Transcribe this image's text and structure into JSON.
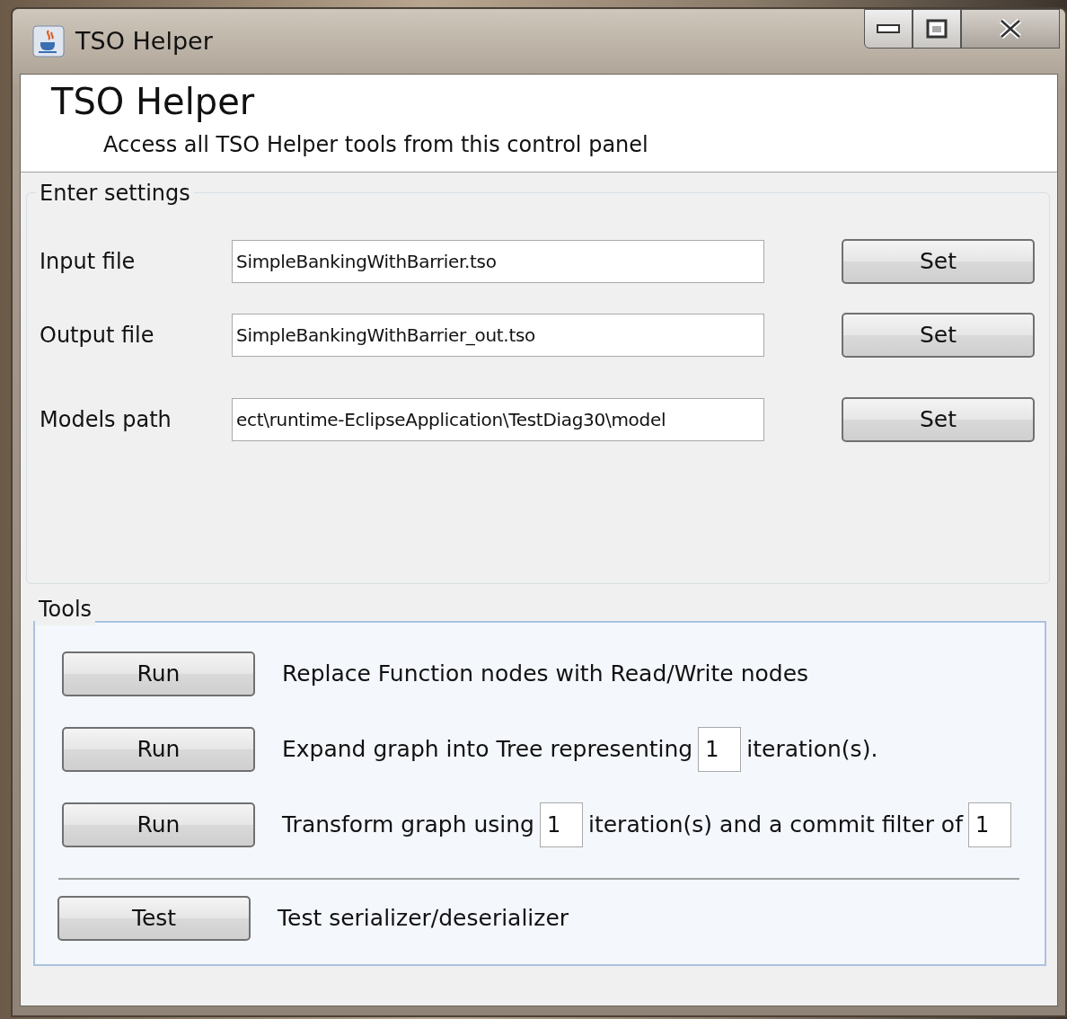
{
  "window": {
    "title": "TSO Helper"
  },
  "header": {
    "title": "TSO Helper",
    "subtitle": "Access all TSO Helper tools from this control panel"
  },
  "settings": {
    "legend": "Enter settings",
    "rows": [
      {
        "label": "Input file",
        "value": "SimpleBankingWithBarrier.tso",
        "button": "Set"
      },
      {
        "label": "Output file",
        "value": "SimpleBankingWithBarrier_out.tso",
        "button": "Set"
      },
      {
        "label": "Models path",
        "value": "ect\\runtime-EclipseApplication\\TestDiag30\\model",
        "button": "Set"
      }
    ]
  },
  "tools": {
    "legend": "Tools",
    "rows": [
      {
        "button": "Run",
        "parts": [
          {
            "kind": "text",
            "text": "Replace Function nodes with Read/Write nodes"
          }
        ]
      },
      {
        "button": "Run",
        "parts": [
          {
            "kind": "text",
            "text": "Expand graph into Tree representing"
          },
          {
            "kind": "field",
            "value": "1"
          },
          {
            "kind": "text",
            "text": "iteration(s)."
          }
        ]
      },
      {
        "button": "Run",
        "parts": [
          {
            "kind": "text",
            "text": "Transform graph using"
          },
          {
            "kind": "field",
            "value": "1"
          },
          {
            "kind": "text",
            "text": "iteration(s) and a commit filter of"
          },
          {
            "kind": "field",
            "value": "1"
          }
        ]
      }
    ],
    "test": {
      "button": "Test",
      "text": "Test serializer/deserializer"
    }
  }
}
